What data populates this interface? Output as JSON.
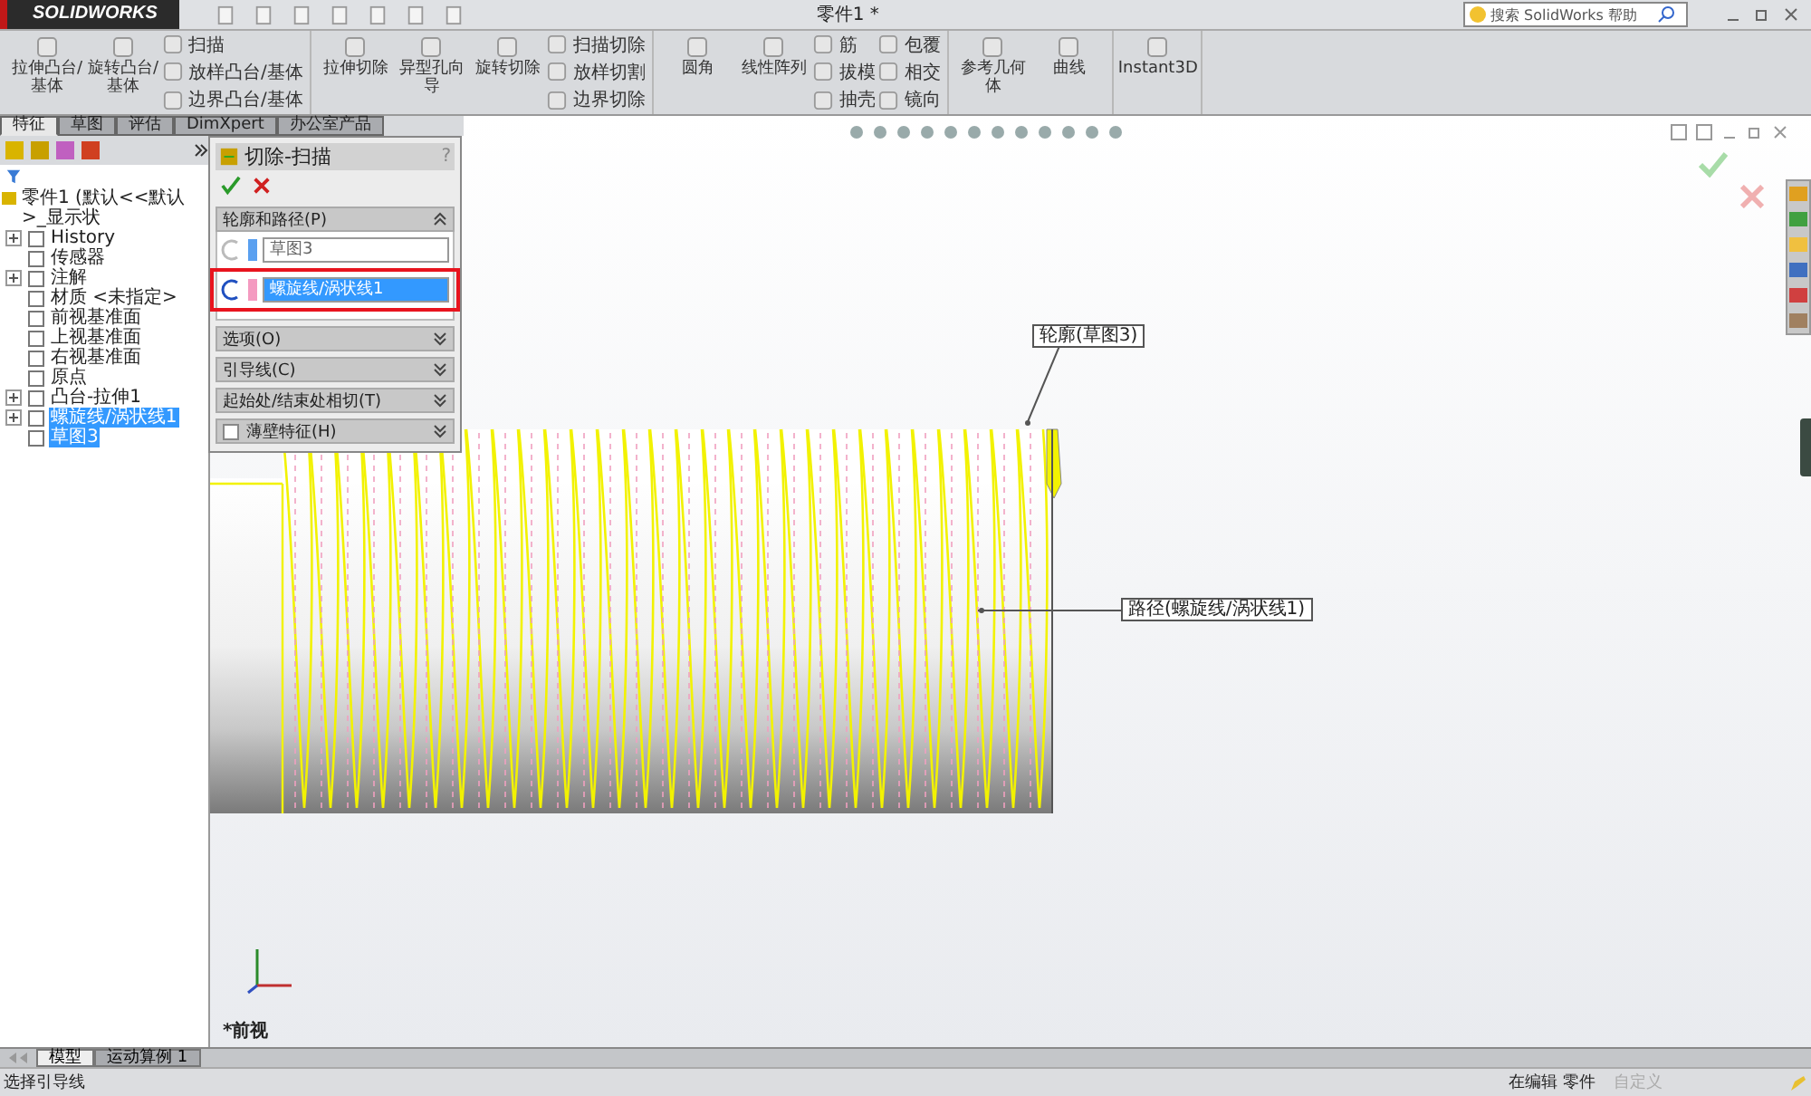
{
  "app": {
    "logo": "SOLIDWORKS",
    "title": "零件1 *",
    "search_placeholder": "搜索 SolidWorks 帮助"
  },
  "ribbon": {
    "groups": [
      [
        {
          "kind": "large",
          "label": "拉伸凸台/基体"
        },
        {
          "kind": "large",
          "label": "旋转凸台/基体"
        },
        {
          "kind": "stack",
          "items": [
            "扫描",
            "放样凸台/基体",
            "边界凸台/基体"
          ]
        }
      ],
      [
        {
          "kind": "large",
          "label": "拉伸切除"
        },
        {
          "kind": "large",
          "label": "异型孔向导"
        },
        {
          "kind": "large",
          "label": "旋转切除"
        },
        {
          "kind": "stack",
          "items": [
            "扫描切除",
            "放样切割",
            "边界切除"
          ]
        }
      ],
      [
        {
          "kind": "large",
          "label": "圆角"
        },
        {
          "kind": "large",
          "label": "线性阵列"
        },
        {
          "kind": "stack",
          "items": [
            "筋",
            "拔模",
            "抽壳"
          ]
        },
        {
          "kind": "stack",
          "items": [
            "包覆",
            "相交",
            "镜向"
          ]
        }
      ],
      [
        {
          "kind": "large",
          "label": "参考几何体"
        },
        {
          "kind": "large",
          "label": "曲线"
        }
      ],
      [
        {
          "kind": "large",
          "label": "Instant3D"
        }
      ]
    ]
  },
  "tabs": [
    {
      "label": "特征",
      "selected": true
    },
    {
      "label": "草图",
      "selected": false
    },
    {
      "label": "评估",
      "selected": false
    },
    {
      "label": "DimXpert",
      "selected": false
    },
    {
      "label": "办公室产品",
      "selected": false
    }
  ],
  "tree": {
    "root": "零件1  (默认<<默认>_显示状",
    "items": [
      {
        "label": "History",
        "expander": true,
        "selected": false
      },
      {
        "label": "传感器",
        "expander": false,
        "selected": false
      },
      {
        "label": "注解",
        "expander": true,
        "selected": false
      },
      {
        "label": "材质 <未指定>",
        "expander": false,
        "selected": false
      },
      {
        "label": "前视基准面",
        "expander": false,
        "selected": false
      },
      {
        "label": "上视基准面",
        "expander": false,
        "selected": false
      },
      {
        "label": "右视基准面",
        "expander": false,
        "selected": false
      },
      {
        "label": "原点",
        "expander": false,
        "selected": false
      },
      {
        "label": "凸台-拉伸1",
        "expander": true,
        "selected": false
      },
      {
        "label": "螺旋线/涡状线1",
        "expander": true,
        "selected": true
      },
      {
        "label": "草图3",
        "expander": false,
        "selected": true
      }
    ]
  },
  "property_manager": {
    "title": "切除-扫描",
    "help": "?",
    "sections": [
      {
        "title": "轮廓和路径(P)",
        "expanded": true,
        "fields": [
          {
            "value": "草图3",
            "selected": false
          },
          {
            "value": "螺旋线/涡状线1",
            "selected": true
          }
        ]
      },
      {
        "title": "选项(O)",
        "expanded": false
      },
      {
        "title": "引导线(C)",
        "expanded": false
      },
      {
        "title": "起始处/结束处相切(T)",
        "expanded": false
      },
      {
        "title": "薄壁特征(H)",
        "expanded": false,
        "checked": false
      }
    ]
  },
  "viewport": {
    "callouts": [
      "轮廓(草图3)",
      "路径(螺旋线/涡状线1)"
    ],
    "view_name": "*前视"
  },
  "bottom_tabs": [
    {
      "label": "模型",
      "selected": true
    },
    {
      "label": "运动算例 1",
      "selected": false
    }
  ],
  "status_bar": {
    "message": "选择引导线",
    "mode": "在编辑 零件",
    "units": "自定义"
  }
}
